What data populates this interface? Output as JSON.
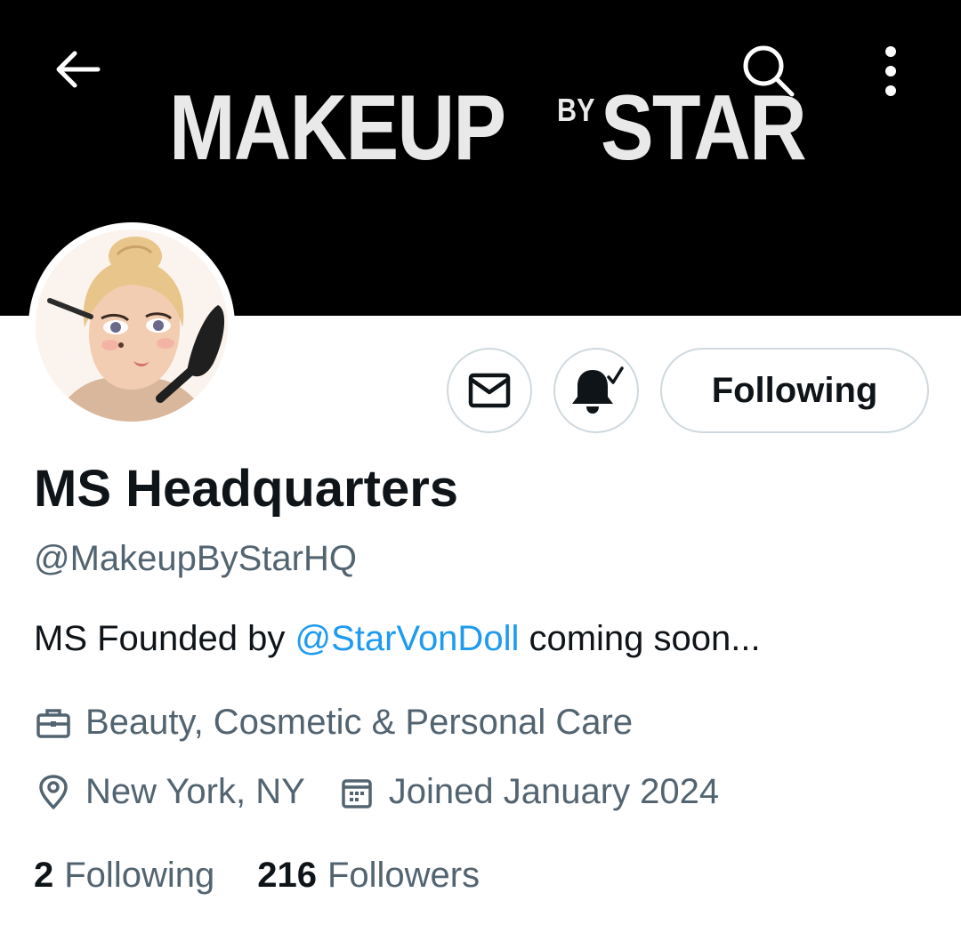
{
  "banner": {
    "logo_makeup": "MAKEUP",
    "logo_by": "BY",
    "logo_star": "STAR"
  },
  "profile": {
    "display_name": "MS Headquarters",
    "handle": "@MakeupByStarHQ",
    "bio_prefix": "MS Founded by ",
    "bio_mention": "@StarVonDoll",
    "bio_suffix": " coming soon...",
    "category": "Beauty, Cosmetic & Personal Care",
    "location": "New York, NY",
    "joined": "Joined January 2024"
  },
  "actions": {
    "following_label": "Following"
  },
  "stats": {
    "following_count": "2",
    "following_label": "Following",
    "followers_count": "216",
    "followers_label": "Followers"
  },
  "icons": {
    "back": "arrow-left-icon",
    "search": "search-icon",
    "more": "more-vertical-icon",
    "mail": "mail-icon",
    "bell": "bell-check-icon",
    "category": "briefcase-icon",
    "location": "location-pin-icon",
    "joined": "calendar-icon"
  },
  "colors": {
    "banner_bg": "#000000",
    "text_primary": "#0f1419",
    "text_secondary": "#536471",
    "link": "#1d9bf0",
    "border": "#cfd9de"
  }
}
